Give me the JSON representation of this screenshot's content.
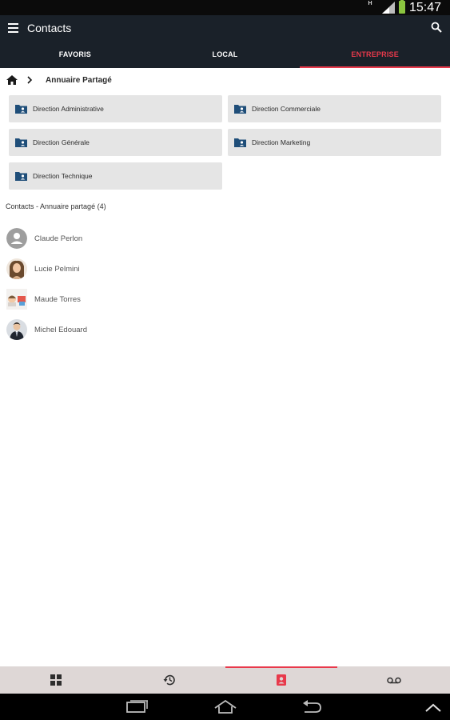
{
  "status_bar": {
    "net_indicator": "H",
    "time": "15:47"
  },
  "app_bar": {
    "title": "Contacts"
  },
  "tabs": [
    {
      "label": "FAVORIS",
      "active": false
    },
    {
      "label": "LOCAL",
      "active": false
    },
    {
      "label": "ENTREPRISE",
      "active": true
    }
  ],
  "breadcrumb": {
    "label": "Annuaire Partagé"
  },
  "folders": [
    {
      "label": "Direction Administrative"
    },
    {
      "label": "Direction Commerciale"
    },
    {
      "label": "Direction Générale"
    },
    {
      "label": "Direction Marketing"
    },
    {
      "label": "Direction Technique"
    }
  ],
  "contacts_section": {
    "title": "Contacts - Annuaire partagé (4)"
  },
  "contacts": [
    {
      "name": "Claude Perlon",
      "avatar": "default-avatar-icon"
    },
    {
      "name": "Lucie Pelmini",
      "avatar": "photo"
    },
    {
      "name": "Maude Torres",
      "avatar": "photo"
    },
    {
      "name": "Michel Edouard",
      "avatar": "photo"
    }
  ],
  "bottom_nav": [
    {
      "icon": "apps-grid-icon",
      "active": false
    },
    {
      "icon": "history-icon",
      "active": false
    },
    {
      "icon": "contacts-icon",
      "active": true
    },
    {
      "icon": "voicemail-icon",
      "active": false
    }
  ],
  "colors": {
    "app_bar_bg": "#1a2129",
    "accent": "#e8394b",
    "folder_bg": "#e5e5e5",
    "folder_icon": "#1f4e79",
    "bottom_nav_bg": "#ded7d6"
  }
}
